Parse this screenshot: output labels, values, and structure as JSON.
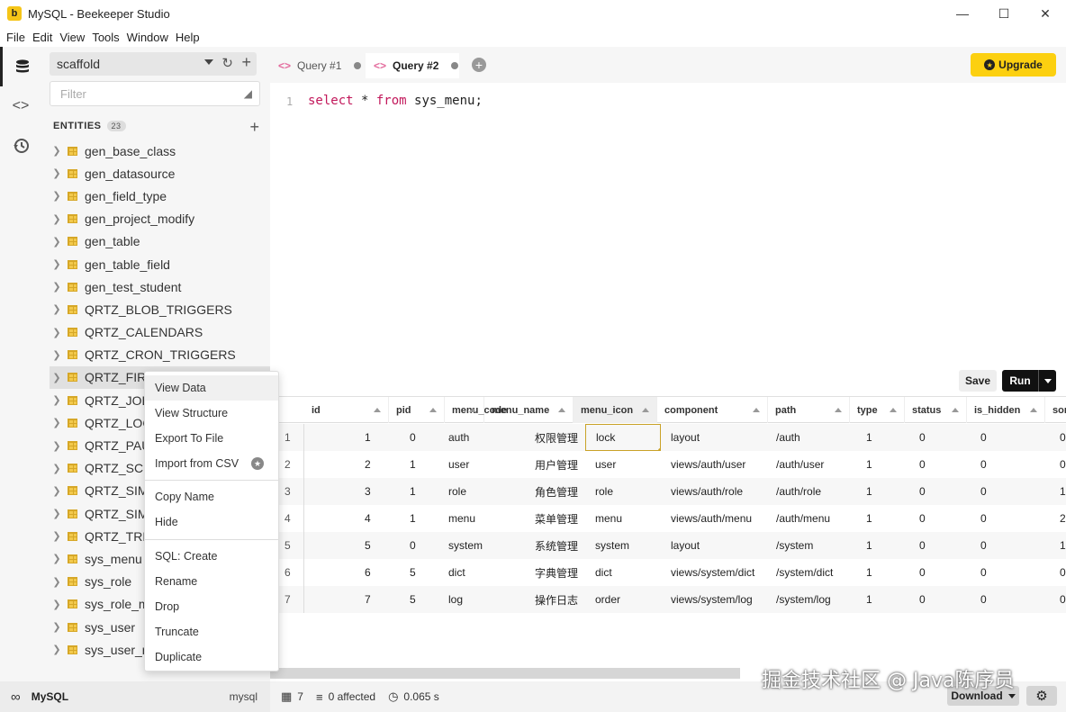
{
  "window": {
    "title": "MySQL - Beekeeper Studio",
    "app_icon_letter": "b"
  },
  "menubar": [
    "File",
    "Edit",
    "View",
    "Tools",
    "Window",
    "Help"
  ],
  "sidebar": {
    "connection": "scaffold",
    "filter_placeholder": "Filter",
    "entities_label": "ENTITIES",
    "entities_count": "23",
    "tables": [
      "gen_base_class",
      "gen_datasource",
      "gen_field_type",
      "gen_project_modify",
      "gen_table",
      "gen_table_field",
      "gen_test_student",
      "QRTZ_BLOB_TRIGGERS",
      "QRTZ_CALENDARS",
      "QRTZ_CRON_TRIGGERS",
      "QRTZ_FIRE",
      "QRTZ_JOB",
      "QRTZ_LOC",
      "QRTZ_PAU",
      "QRTZ_SCH",
      "QRTZ_SIM",
      "QRTZ_SIM",
      "QRTZ_TRIG",
      "sys_menu",
      "sys_role",
      "sys_role_m",
      "sys_user",
      "sys_user_r"
    ],
    "selected_index": 10
  },
  "footer": {
    "db_name": "MySQL",
    "db_type": "mysql"
  },
  "tabs": [
    {
      "label": "Query #1",
      "active": false
    },
    {
      "label": "Query #2",
      "active": true
    }
  ],
  "upgrade_label": "Upgrade",
  "editor": {
    "line_number": "1",
    "kw1": "select",
    "star": " * ",
    "kw2": "from",
    "rest": " sys_menu;"
  },
  "actions": {
    "save": "Save",
    "run": "Run"
  },
  "results": {
    "columns": [
      "id",
      "pid",
      "menu_code",
      "menu_name",
      "menu_icon",
      "component",
      "path",
      "type",
      "status",
      "is_hidden",
      "sor"
    ],
    "rows": [
      [
        "1",
        "1",
        "0",
        "auth",
        "权限管理",
        "lock",
        "layout",
        "/auth",
        "1",
        "0",
        "0",
        "0"
      ],
      [
        "2",
        "2",
        "1",
        "user",
        "用户管理",
        "user",
        "views/auth/user",
        "/auth/user",
        "1",
        "0",
        "0",
        "0"
      ],
      [
        "3",
        "3",
        "1",
        "role",
        "角色管理",
        "role",
        "views/auth/role",
        "/auth/role",
        "1",
        "0",
        "0",
        "1"
      ],
      [
        "4",
        "4",
        "1",
        "menu",
        "菜单管理",
        "menu",
        "views/auth/menu",
        "/auth/menu",
        "1",
        "0",
        "0",
        "2"
      ],
      [
        "5",
        "5",
        "0",
        "system",
        "系统管理",
        "system",
        "layout",
        "/system",
        "1",
        "0",
        "0",
        "1"
      ],
      [
        "6",
        "6",
        "5",
        "dict",
        "字典管理",
        "dict",
        "views/system/dict",
        "/system/dict",
        "1",
        "0",
        "0",
        "0"
      ],
      [
        "7",
        "7",
        "5",
        "log",
        "操作日志",
        "order",
        "views/system/log",
        "/system/log",
        "1",
        "0",
        "0",
        "0"
      ]
    ]
  },
  "context_menu": [
    "View Data",
    "View Structure",
    "Export To File",
    "Import from CSV",
    "Copy Name",
    "Hide",
    "SQL: Create",
    "Rename",
    "Drop",
    "Truncate",
    "Duplicate"
  ],
  "status": {
    "rows": "7",
    "affected": "0 affected",
    "time": "0.065 s",
    "download": "Download"
  },
  "watermark": "掘金技术社区 @ Java陈序员",
  "colors": {
    "accent_yellow": "#fcd010",
    "keyword_pink": "#c2185b",
    "run_black": "#111111"
  }
}
